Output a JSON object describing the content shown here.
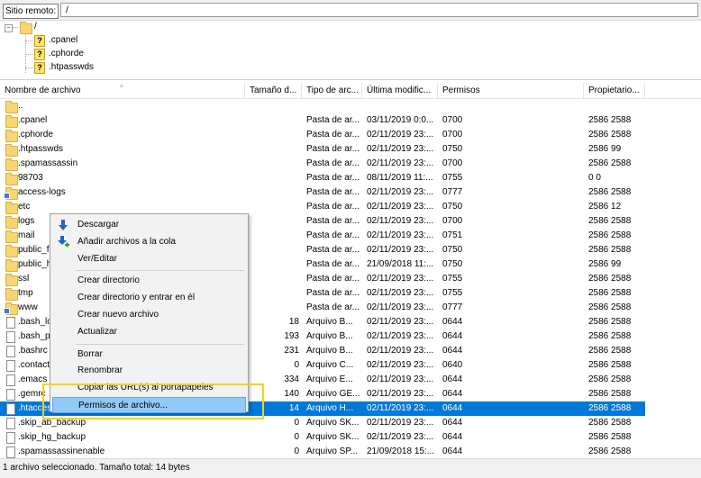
{
  "remote": {
    "label": "Sitio remoto:",
    "path": "/"
  },
  "tree": {
    "root": "/",
    "children": [
      ".cpanel",
      ".cphorde",
      ".htpasswds"
    ]
  },
  "columns": [
    "Nombre de archivo",
    "Tamaño d...",
    "Tipo de arc...",
    "Última modific...",
    "Permisos",
    "Propietario..."
  ],
  "files": [
    {
      "name": "..",
      "size": "",
      "type": "",
      "date": "",
      "perms": "",
      "owner": "",
      "icon": "folder-icon"
    },
    {
      "name": ".cpanel",
      "size": "",
      "type": "Pasta de ar...",
      "date": "03/11/2019 0:0...",
      "perms": "0700",
      "owner": "2586 2588",
      "icon": "folder-icon"
    },
    {
      "name": ".cphorde",
      "size": "",
      "type": "Pasta de ar...",
      "date": "02/11/2019 23:...",
      "perms": "0700",
      "owner": "2586 2588",
      "icon": "folder-icon"
    },
    {
      "name": ".htpasswds",
      "size": "",
      "type": "Pasta de ar...",
      "date": "02/11/2019 23:...",
      "perms": "0750",
      "owner": "2586 99",
      "icon": "folder-icon"
    },
    {
      "name": ".spamassassin",
      "size": "",
      "type": "Pasta de ar...",
      "date": "02/11/2019 23:...",
      "perms": "0700",
      "owner": "2586 2588",
      "icon": "folder-icon"
    },
    {
      "name": "98703",
      "size": "",
      "type": "Pasta de ar...",
      "date": "08/11/2019 11:...",
      "perms": "0755",
      "owner": "0 0",
      "icon": "folder-icon"
    },
    {
      "name": "access-logs",
      "size": "",
      "type": "Pasta de ar...",
      "date": "02/11/2019 23:...",
      "perms": "0777",
      "owner": "2586 2588",
      "icon": "folder-link-icon"
    },
    {
      "name": "etc",
      "size": "",
      "type": "Pasta de ar...",
      "date": "02/11/2019 23:...",
      "perms": "0750",
      "owner": "2586 12",
      "icon": "folder-icon"
    },
    {
      "name": "logs",
      "size": "",
      "type": "Pasta de ar...",
      "date": "02/11/2019 23:...",
      "perms": "0700",
      "owner": "2586 2588",
      "icon": "folder-icon"
    },
    {
      "name": "mail",
      "size": "",
      "type": "Pasta de ar...",
      "date": "02/11/2019 23:...",
      "perms": "0751",
      "owner": "2586 2588",
      "icon": "folder-icon"
    },
    {
      "name": "public_f",
      "size": "",
      "type": "Pasta de ar...",
      "date": "02/11/2019 23:...",
      "perms": "0750",
      "owner": "2586 2588",
      "icon": "folder-icon"
    },
    {
      "name": "public_h",
      "size": "",
      "type": "Pasta de ar...",
      "date": "21/09/2018 11:...",
      "perms": "0750",
      "owner": "2586 99",
      "icon": "folder-icon"
    },
    {
      "name": "ssl",
      "size": "",
      "type": "Pasta de ar...",
      "date": "02/11/2019 23:...",
      "perms": "0755",
      "owner": "2586 2588",
      "icon": "folder-icon"
    },
    {
      "name": "tmp",
      "size": "",
      "type": "Pasta de ar...",
      "date": "02/11/2019 23:...",
      "perms": "0755",
      "owner": "2586 2588",
      "icon": "folder-icon"
    },
    {
      "name": "www",
      "size": "",
      "type": "Pasta de ar...",
      "date": "02/11/2019 23:...",
      "perms": "0777",
      "owner": "2586 2588",
      "icon": "folder-link-icon"
    },
    {
      "name": ".bash_lo",
      "size": "18",
      "type": "Arquivo B...",
      "date": "02/11/2019 23:...",
      "perms": "0644",
      "owner": "2586 2588",
      "icon": "file-icon"
    },
    {
      "name": ".bash_pr",
      "size": "193",
      "type": "Arquivo B...",
      "date": "02/11/2019 23:...",
      "perms": "0644",
      "owner": "2586 2588",
      "icon": "file-icon"
    },
    {
      "name": ".bashrc",
      "size": "231",
      "type": "Arquivo B...",
      "date": "02/11/2019 23:...",
      "perms": "0644",
      "owner": "2586 2588",
      "icon": "file-icon"
    },
    {
      "name": ".contact",
      "size": "0",
      "type": "Arquivo C...",
      "date": "02/11/2019 23:...",
      "perms": "0640",
      "owner": "2586 2588",
      "icon": "file-icon"
    },
    {
      "name": ".emacs",
      "size": "334",
      "type": "Arquivo E...",
      "date": "02/11/2019 23:...",
      "perms": "0644",
      "owner": "2586 2588",
      "icon": "file-icon"
    },
    {
      "name": ".gemrc",
      "size": "140",
      "type": "Arquivo GE...",
      "date": "02/11/2019 23:...",
      "perms": "0644",
      "owner": "2586 2588",
      "icon": "file-icon"
    },
    {
      "name": ".htaccess",
      "size": "14",
      "type": "Arquivo H...",
      "date": "02/11/2019 23:...",
      "perms": "0644",
      "owner": "2586 2588",
      "icon": "file-icon",
      "selected": true
    },
    {
      "name": ".skip_ab_backup",
      "size": "0",
      "type": "Arquivo SK...",
      "date": "02/11/2019 23:...",
      "perms": "0644",
      "owner": "2586 2588",
      "icon": "file-icon"
    },
    {
      "name": ".skip_hg_backup",
      "size": "0",
      "type": "Arquivo SK...",
      "date": "02/11/2019 23:...",
      "perms": "0644",
      "owner": "2586 2588",
      "icon": "file-icon"
    },
    {
      "name": ".spamassassinenable",
      "size": "0",
      "type": "Arquivo SP...",
      "date": "21/09/2018 15:...",
      "perms": "0644",
      "owner": "2586 2588",
      "icon": "file-icon"
    }
  ],
  "context_menu": {
    "items": [
      {
        "label": "Descargar",
        "icon": "download-arrow-icon"
      },
      {
        "label": "Añadir archivos a la cola",
        "icon": "add-to-queue-icon"
      },
      {
        "label": "Ver/Editar",
        "icon": ""
      },
      {
        "separator": true
      },
      {
        "label": "Crear directorio"
      },
      {
        "label": "Crear directorio y entrar en él"
      },
      {
        "label": "Crear nuevo archivo"
      },
      {
        "label": "Actualizar"
      },
      {
        "separator": true
      },
      {
        "label": "Borrar"
      },
      {
        "label": "Renombrar"
      },
      {
        "label": "Copiar las URL(s) al portapapeles"
      },
      {
        "label": "Permisos de archivo...",
        "highlighted": true
      }
    ]
  },
  "status": "1 archivo seleccionado. Tamaño total: 14 bytes",
  "colors": {
    "selection": "#0078d7",
    "menu_highlight": "#91c9f7",
    "annotation_box": "#f5d21a",
    "folder": "#f6d670"
  }
}
